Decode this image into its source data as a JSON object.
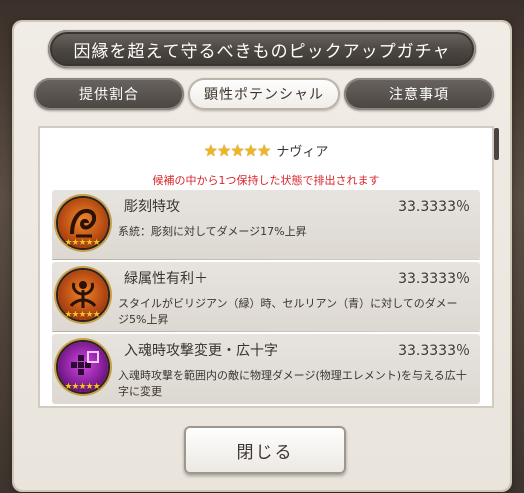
{
  "dialog": {
    "title": "因縁を超えて守るべきものピックアップガチャ",
    "tabs": [
      {
        "label": "提供割合",
        "active": false
      },
      {
        "label": "顕性ポテンシャル",
        "active": true
      },
      {
        "label": "注意事項",
        "active": false
      }
    ],
    "close_label": "閉じる"
  },
  "character": {
    "stars": "★★★★★",
    "name": "ナヴィア",
    "notice": "候補の中から1つ保持した状態で排出されます"
  },
  "potentials": [
    {
      "title": "彫刻特攻",
      "rate": "33.3333％",
      "description": "系統：彫刻に対してダメージ17%上昇",
      "medal_stars": "★★★★★",
      "icon": "sculpture-slayer-icon"
    },
    {
      "title": "緑属性有利＋",
      "rate": "33.3333％",
      "description": "スタイルがビリジアン（緑）時、セルリアン（青）に対してのダメージ5%上昇",
      "medal_stars": "★★★★★",
      "icon": "green-element-advantage-icon"
    },
    {
      "title": "入魂時攻撃変更・広十字",
      "rate": "33.3333％",
      "description": "入魂時攻撃を範囲内の敵に物理ダメージ(物理エレメント)を与える広十字に変更",
      "medal_stars": "★★★★★",
      "icon": "wide-cross-attack-icon"
    }
  ],
  "colors": {
    "accent_red": "#d8252b",
    "star_gold": "#f2b51b",
    "medal_orange": "#d9621a",
    "medal_purple": "#a020b0"
  }
}
